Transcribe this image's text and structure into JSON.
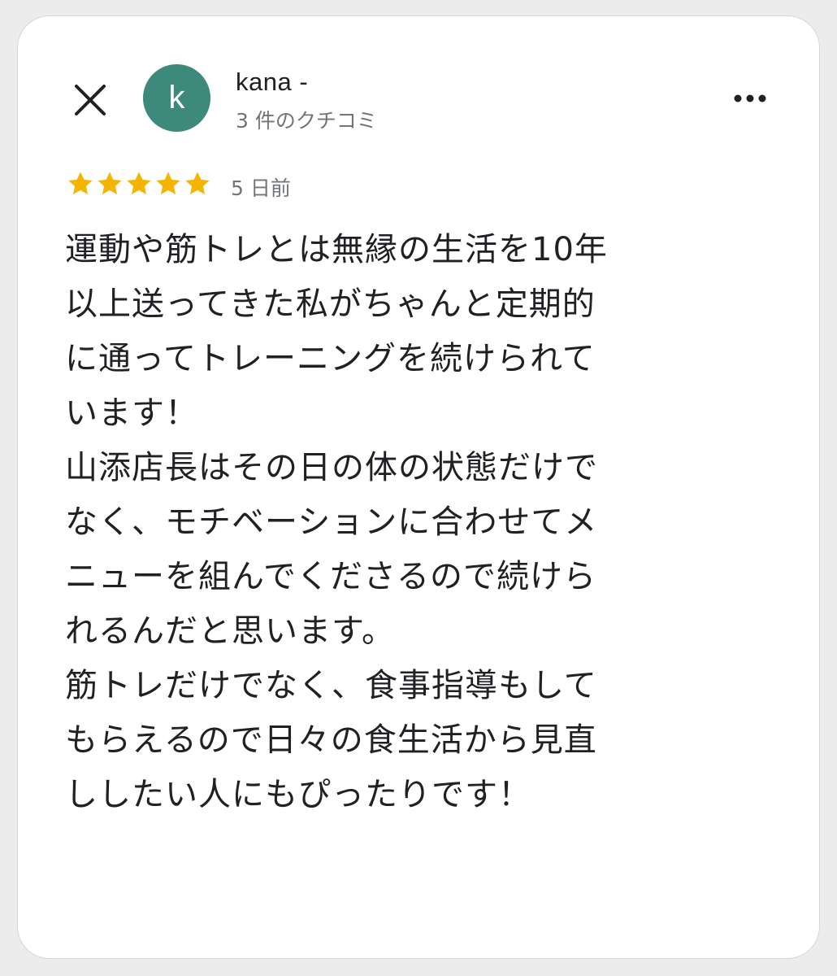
{
  "header": {
    "close_icon": "close-icon",
    "more_icon": "more-horizontal-icon"
  },
  "reviewer": {
    "avatar_letter": "k",
    "avatar_color": "#3d8a7c",
    "name": "kana -",
    "review_count": "3 件のクチコミ"
  },
  "rating": {
    "stars": 5,
    "max_stars": 5,
    "star_color": "#f4b400",
    "time_ago": "5 日前"
  },
  "review": {
    "lines": [
      "運動や筋トレとは無縁の生活を10年",
      "以上送ってきた私がちゃんと定期的",
      "に通ってトレーニングを続けられて",
      "います！",
      "山添店長はその日の体の状態だけで",
      "なく、モチベーションに合わせてメ",
      "ニューを組んでくださるので続けら",
      "れるんだと思います。",
      "筋トレだけでなく、食事指導もして",
      "もらえるので日々の食生活から見直",
      "ししたい人にもぴったりです！"
    ]
  }
}
